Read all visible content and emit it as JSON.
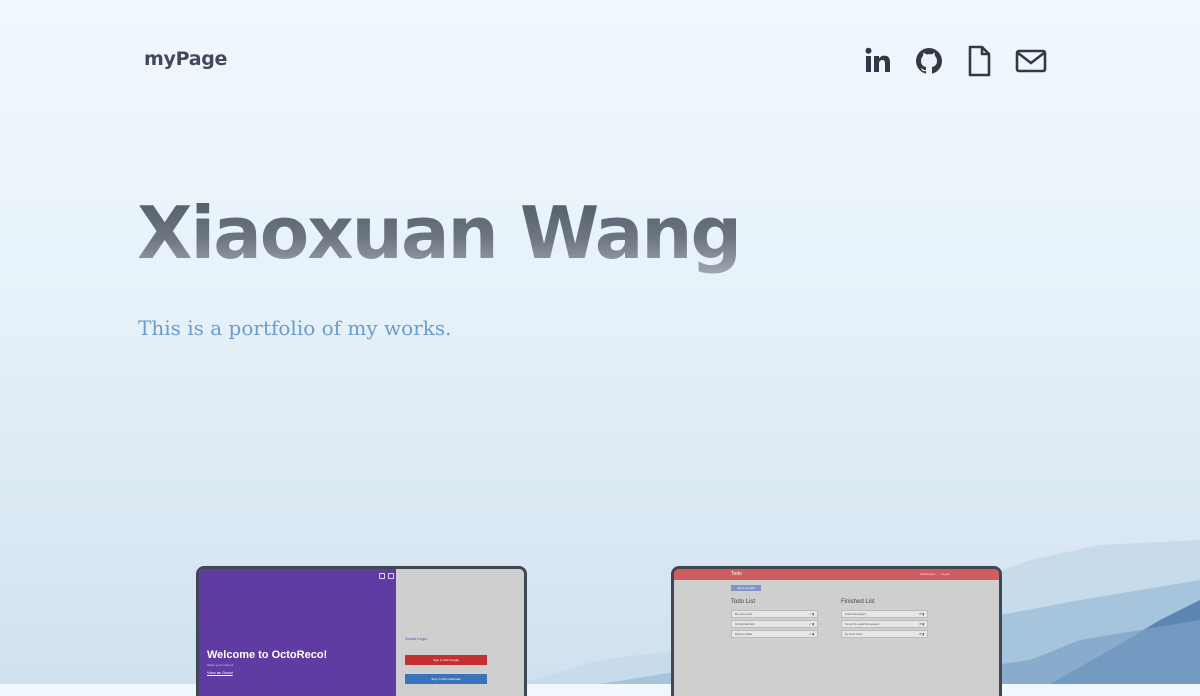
{
  "nav": {
    "logo": "myPage",
    "icons": [
      "linkedin-icon",
      "github-icon",
      "resume-document-icon",
      "mail-icon"
    ]
  },
  "hero": {
    "name": "Xiaoxuan Wang",
    "subtitle": "This is a portfolio of my works."
  },
  "projects": [
    {
      "welcome": "Welcome to OctoReco!",
      "tagline": "Share your moment",
      "guest_link": "View as Guest",
      "social_title": "Social Login",
      "google_button": "Sign in with Google",
      "facebook_button": "Sign in with Facebook"
    },
    {
      "brand": "Todo",
      "nav_links": [
        "Dashboard",
        "Logout"
      ],
      "add_button": "Add a new Task",
      "todo_heading": "Todo List",
      "finished_heading": "Finished List",
      "todo_items": [
        "Buy some fruits",
        "Fill important form",
        "Discuss update"
      ],
      "finished_items": [
        "Finish todo project",
        "Go out for a walk this weekend",
        "Fly to the moon"
      ]
    }
  ],
  "colors": {
    "background": "#e6f1f9",
    "logo_text": "#3c4a5a",
    "subtitle": "#6c9cc8",
    "octo_purple": "#5f3ba2",
    "todo_red": "#cf5c5e"
  }
}
